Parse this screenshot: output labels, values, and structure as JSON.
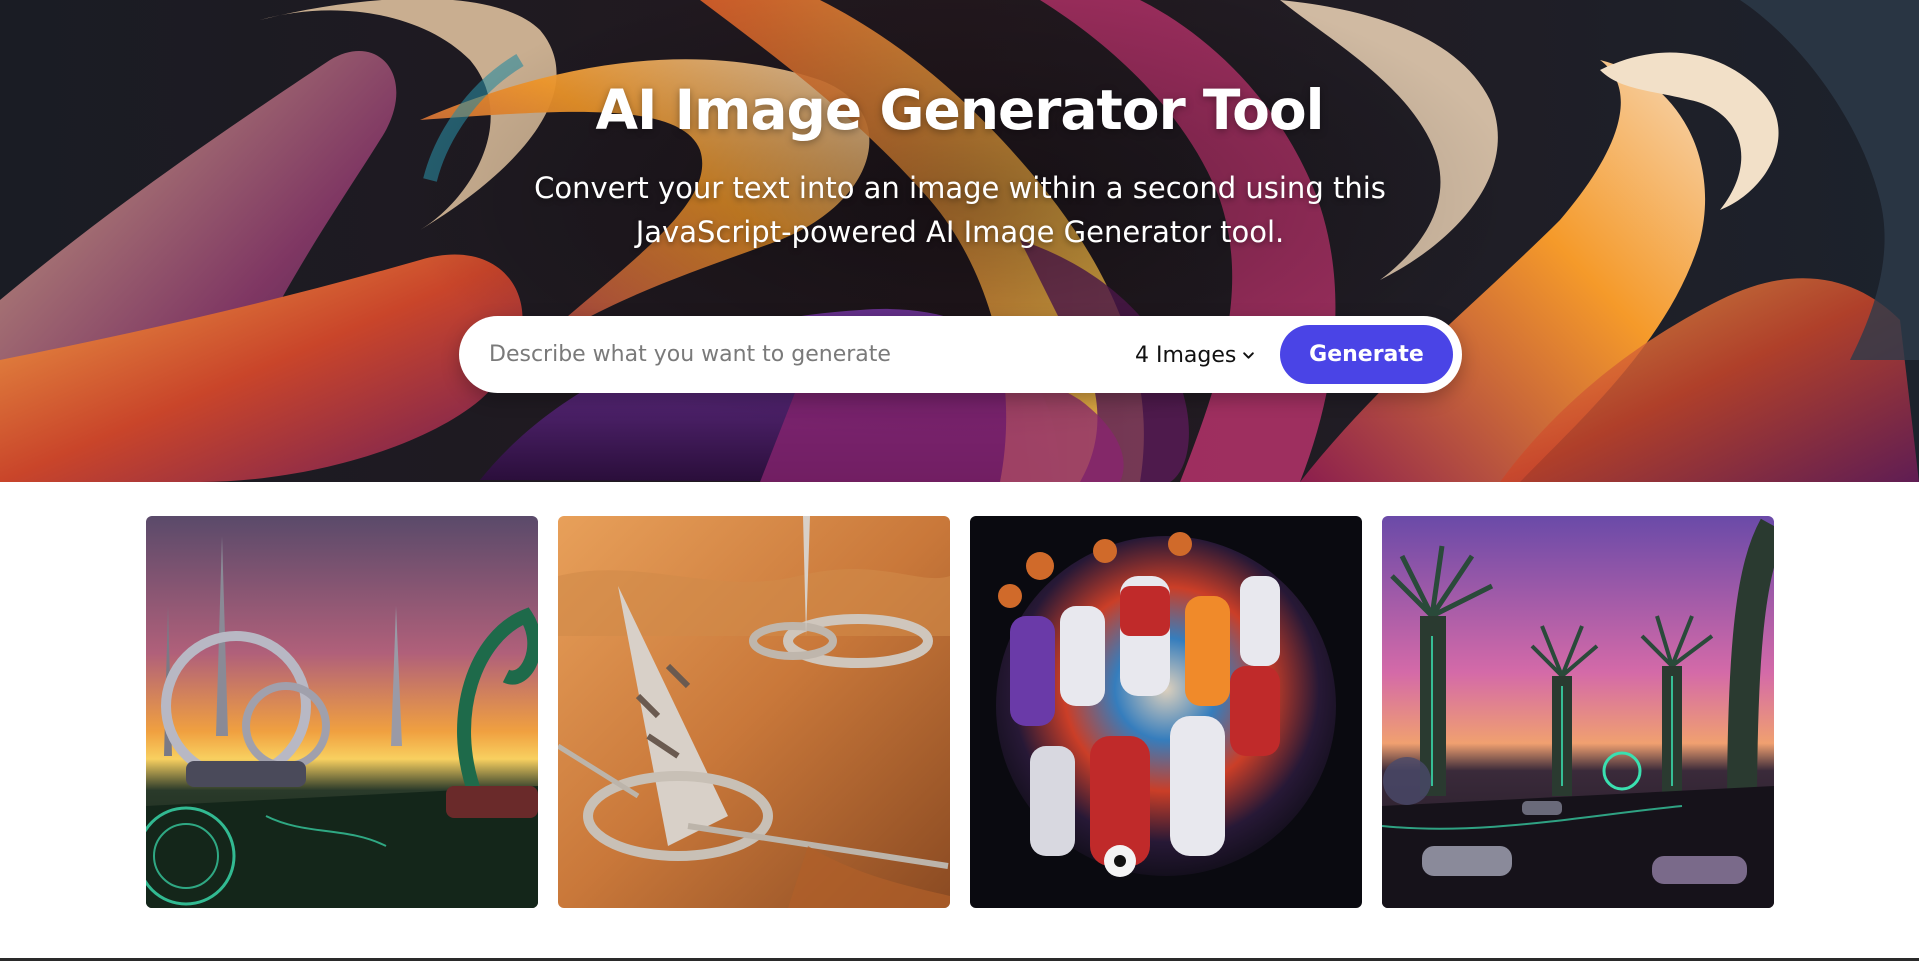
{
  "hero": {
    "title": "AI Image Generator Tool",
    "subtitle_line1": "Convert your text into an image within a second using this",
    "subtitle_line2": "JavaScript-powered AI Image Generator tool."
  },
  "search": {
    "placeholder": "Describe what you want to generate",
    "value": "",
    "image_count": "4 Images",
    "generate_label": "Generate"
  },
  "gallery": {
    "images": [
      {
        "name": "futuristic-spires-sunset-image"
      },
      {
        "name": "desert-alien-structure-image"
      },
      {
        "name": "sports-athletes-collage-image"
      },
      {
        "name": "neon-tree-city-dusk-image"
      }
    ]
  },
  "colors": {
    "accent": "#4a44e6",
    "hero_dark": "#14161c",
    "page_background": "#ffffff"
  }
}
